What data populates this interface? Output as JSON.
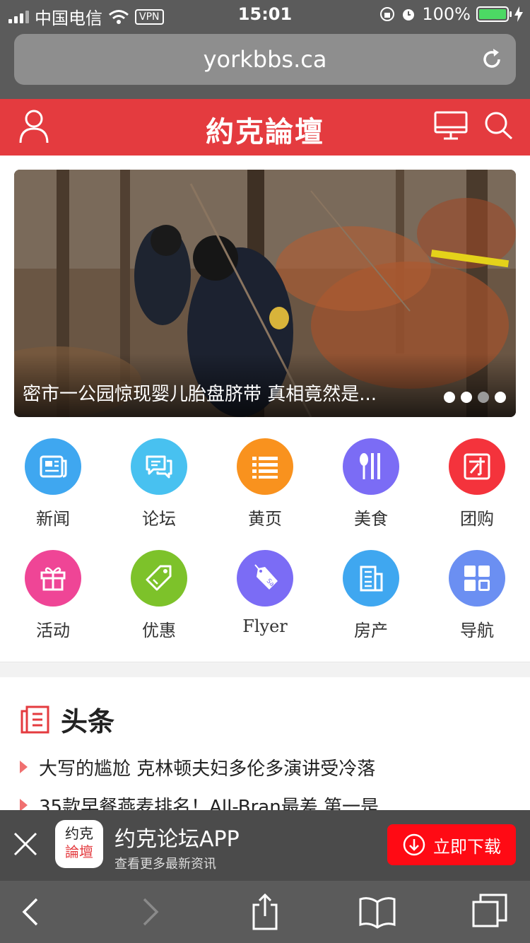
{
  "status": {
    "carrier": "中国电信",
    "vpn": "VPN",
    "time": "15:01",
    "battery": "100%",
    "battery_level": 1.0
  },
  "browser": {
    "url": "yorkbbs.ca"
  },
  "header": {
    "logo": "約克論壇",
    "accent_color": "#e43b3f"
  },
  "hero": {
    "caption": "密市一公园惊现婴儿胎盘脐带 真相竟然是...",
    "slide_count": 4,
    "active_slide": 3
  },
  "grid": {
    "items": [
      {
        "label": "新闻",
        "icon": "newspaper-icon",
        "color": "#3fa7f0"
      },
      {
        "label": "论坛",
        "icon": "chat-bubbles-icon",
        "color": "#48c1f0"
      },
      {
        "label": "黄页",
        "icon": "list-icon",
        "color": "#f9921e"
      },
      {
        "label": "美食",
        "icon": "utensils-icon",
        "color": "#7b6cf5"
      },
      {
        "label": "团购",
        "icon": "group-buy-icon",
        "color": "#f4333c"
      },
      {
        "label": "活动",
        "icon": "gift-icon",
        "color": "#ef4596"
      },
      {
        "label": "优惠",
        "icon": "tag-icon",
        "color": "#7dc22a"
      },
      {
        "label": "Flyer",
        "icon": "sale-tag-icon",
        "color": "#7b6cf5"
      },
      {
        "label": "房产",
        "icon": "building-icon",
        "color": "#3fa7f0"
      },
      {
        "label": "导航",
        "icon": "grid-apps-icon",
        "color": "#6b8ff2"
      }
    ]
  },
  "headlines": {
    "title": "头条",
    "items": [
      "大写的尴尬 克林顿夫妇多伦多演讲受冷落",
      "35款早餐燕麦排名！All-Bran最差 第一是"
    ]
  },
  "banner": {
    "app_icon_line1": "约克",
    "app_icon_line2": "論壇",
    "name": "约克论坛APP",
    "subtitle": "查看更多最新资讯",
    "download_label": "立即下载"
  }
}
